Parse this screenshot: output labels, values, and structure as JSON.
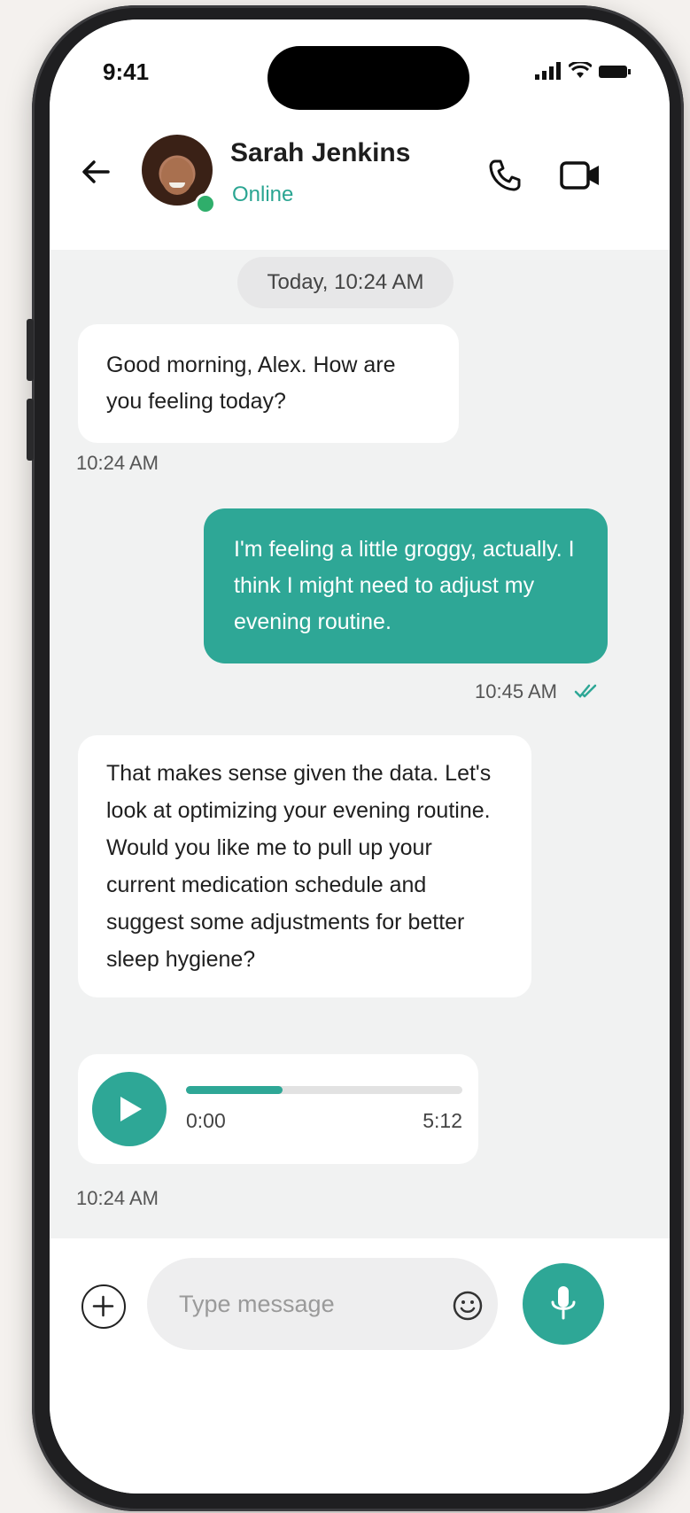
{
  "status_bar": {
    "time": "9:41"
  },
  "header": {
    "contact_name": "Sarah Jenkins",
    "contact_status": "Online"
  },
  "chat": {
    "date_divider": "Today, 10:24 AM",
    "messages": [
      {
        "direction": "incoming",
        "text": "Good morning, Alex. How are you feeling today?",
        "time": "10:24 AM"
      },
      {
        "direction": "outgoing",
        "text": "I'm feeling a little groggy, actually. I think I might need to adjust my evening routine.",
        "time": "10:45 AM",
        "read": true
      },
      {
        "direction": "incoming",
        "text": "That makes sense given the data. Let's look at optimizing your evening routine. Would you like me to pull up your current medication schedule and suggest some adjustments for better sleep hygiene?"
      }
    ],
    "voice_note": {
      "current": "0:00",
      "duration": "5:12",
      "progress": 0.35,
      "time": "10:24 AM"
    }
  },
  "composer": {
    "placeholder": "Type message"
  },
  "icons": [
    "back-arrow-icon",
    "phone-icon",
    "video-camera-icon",
    "play-icon",
    "plus-icon",
    "emoji-icon",
    "microphone-icon",
    "double-check-icon",
    "signal-icon",
    "wifi-icon",
    "battery-icon"
  ],
  "colors": {
    "accent": "#2ea796",
    "online": "#2fae6b",
    "background": "#f1f2f2"
  }
}
